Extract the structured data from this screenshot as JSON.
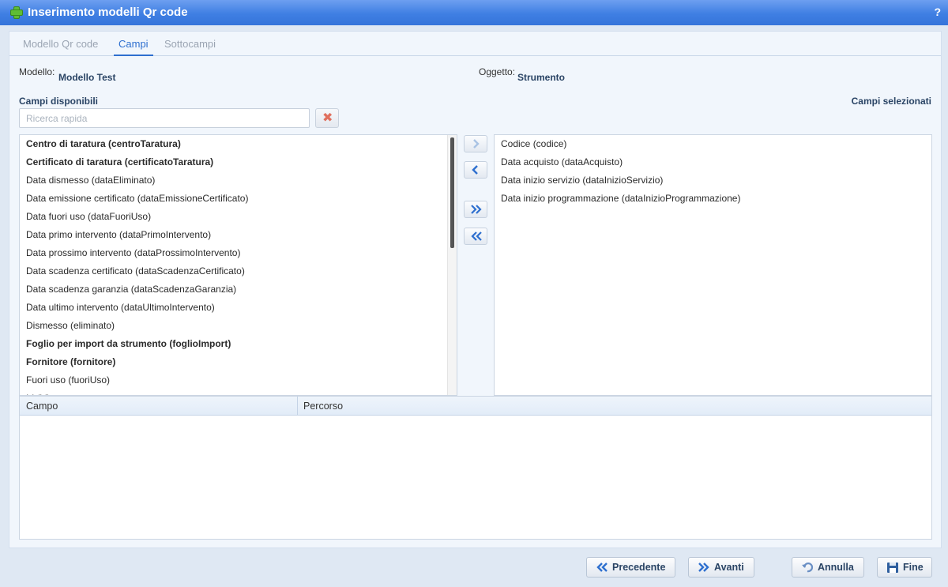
{
  "window": {
    "title": "Inserimento modelli Qr code",
    "help": "?"
  },
  "tabs": [
    {
      "label": "Modello Qr code"
    },
    {
      "label": "Campi"
    },
    {
      "label": "Sottocampi"
    }
  ],
  "info": {
    "modello_label": "Modello:",
    "modello_value": "Modello Test",
    "oggetto_label": "Oggetto:",
    "oggetto_value": "Strumento"
  },
  "available": {
    "title": "Campi disponibili",
    "search_placeholder": "Ricerca rapida",
    "items": [
      {
        "label": "Centro di taratura (centroTaratura)",
        "bold": true
      },
      {
        "label": "Certificato di taratura (certificatoTaratura)",
        "bold": true
      },
      {
        "label": "Data dismesso (dataEliminato)",
        "bold": false
      },
      {
        "label": "Data emissione certificato (dataEmissioneCertificato)",
        "bold": false
      },
      {
        "label": "Data fuori uso (dataFuoriUso)",
        "bold": false
      },
      {
        "label": "Data primo intervento (dataPrimoIntervento)",
        "bold": false
      },
      {
        "label": "Data prossimo intervento (dataProssimoIntervento)",
        "bold": false
      },
      {
        "label": "Data scadenza certificato (dataScadenzaCertificato)",
        "bold": false
      },
      {
        "label": "Data scadenza garanzia (dataScadenzaGaranzia)",
        "bold": false
      },
      {
        "label": "Data ultimo intervento (dataUltimoIntervento)",
        "bold": false
      },
      {
        "label": "Dismesso (eliminato)",
        "bold": false
      },
      {
        "label": "Foglio per import da strumento (foglioImport)",
        "bold": true
      },
      {
        "label": "Fornitore (fornitore)",
        "bold": true
      },
      {
        "label": "Fuori uso (fuoriUso)",
        "bold": false
      },
      {
        "label": "Id (id)",
        "bold": false
      }
    ]
  },
  "selected": {
    "title": "Campi selezionati",
    "items": [
      {
        "label": "Codice (codice)"
      },
      {
        "label": "Data acquisto (dataAcquisto)"
      },
      {
        "label": "Data inizio servizio (dataInizioServizio)"
      },
      {
        "label": "Data inizio programmazione (dataInizioProgrammazione)"
      }
    ]
  },
  "grid": {
    "col_campo": "Campo",
    "col_percorso": "Percorso"
  },
  "buttons": {
    "precedente": "Precedente",
    "avanti": "Avanti",
    "annulla": "Annulla",
    "fine": "Fine"
  },
  "icons": {
    "move_right": "chevron-right-icon",
    "move_left": "chevron-left-icon",
    "move_all_right": "double-chevron-right-icon",
    "move_all_left": "double-chevron-left-icon",
    "clear": "close-icon",
    "undo": "undo-icon",
    "save": "floppy-disk-icon"
  },
  "colors": {
    "titlebar": "#3f7fe3",
    "accent": "#2e6fcf",
    "label_dark": "#2a4465"
  }
}
